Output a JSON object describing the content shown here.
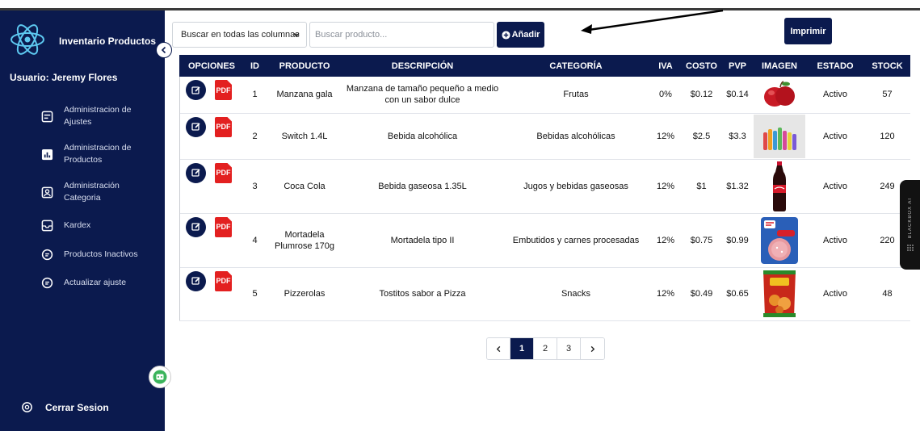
{
  "sidebar": {
    "brand_title": "Inventario Productos",
    "user_label": "Usuario: Jeremy Flores",
    "items": [
      {
        "label": "Administracion de Ajustes",
        "icon": "settings-box-icon"
      },
      {
        "label": "Administracion de Productos",
        "icon": "chart-box-icon"
      },
      {
        "label": "Administración Categoria",
        "icon": "user-box-icon"
      },
      {
        "label": "Kardex",
        "icon": "inbox-icon"
      },
      {
        "label": "Productos Inactivos",
        "icon": "circle-list-icon"
      },
      {
        "label": "Actualizar ajuste",
        "icon": "circle-list-icon"
      }
    ],
    "logout_label": "Cerrar Sesion"
  },
  "toolbar": {
    "search_scope": "Buscar en todas las columnas",
    "search_placeholder": "Buscar producto...",
    "add_label": "Añadir",
    "print_label": "Imprimir"
  },
  "table": {
    "headers": [
      "OPCIONES",
      "ID",
      "PRODUCTO",
      "DESCRIPCIÓN",
      "CATEGORÍA",
      "IVA",
      "COSTO",
      "PVP",
      "IMAGEN",
      "ESTADO",
      "STOCK"
    ],
    "pdf_label": "PDF",
    "rows": [
      {
        "id": "1",
        "producto": "Manzana gala",
        "descripcion": "Manzana de tamaño pequeño a medio con un sabor dulce",
        "categoria": "Frutas",
        "iva": "0%",
        "costo": "$0.12",
        "pvp": "$0.14",
        "imagen": "apple",
        "estado": "Activo",
        "stock": "57"
      },
      {
        "id": "2",
        "producto": "Switch 1.4L",
        "descripcion": "Bebida alcohólica",
        "categoria": "Bebidas alcohólicas",
        "iva": "12%",
        "costo": "$2.5",
        "pvp": "$3.3",
        "imagen": "bottles",
        "estado": "Activo",
        "stock": "120"
      },
      {
        "id": "3",
        "producto": "Coca Cola",
        "descripcion": "Bebida gaseosa 1.35L",
        "categoria": "Jugos y bebidas gaseosas",
        "iva": "12%",
        "costo": "$1",
        "pvp": "$1.32",
        "imagen": "cola-bottle",
        "estado": "Activo",
        "stock": "249"
      },
      {
        "id": "4",
        "producto": "Mortadela Plumrose 170g",
        "descripcion": "Mortadela tipo II",
        "categoria": "Embutidos y carnes procesadas",
        "iva": "12%",
        "costo": "$0.75",
        "pvp": "$0.99",
        "imagen": "mortadela-pack",
        "estado": "Activo",
        "stock": "220"
      },
      {
        "id": "5",
        "producto": "Pizzerolas",
        "descripcion": "Tostitos sabor a Pizza",
        "categoria": "Snacks",
        "iva": "12%",
        "costo": "$0.49",
        "pvp": "$0.65",
        "imagen": "snack-bag",
        "estado": "Activo",
        "stock": "48"
      }
    ]
  },
  "pagination": {
    "pages": [
      "1",
      "2",
      "3"
    ],
    "active": "1"
  },
  "widget": {
    "label": "BLACKBOX AI"
  },
  "colors": {
    "primary": "#0b1a4e",
    "pdf": "#e32020"
  }
}
